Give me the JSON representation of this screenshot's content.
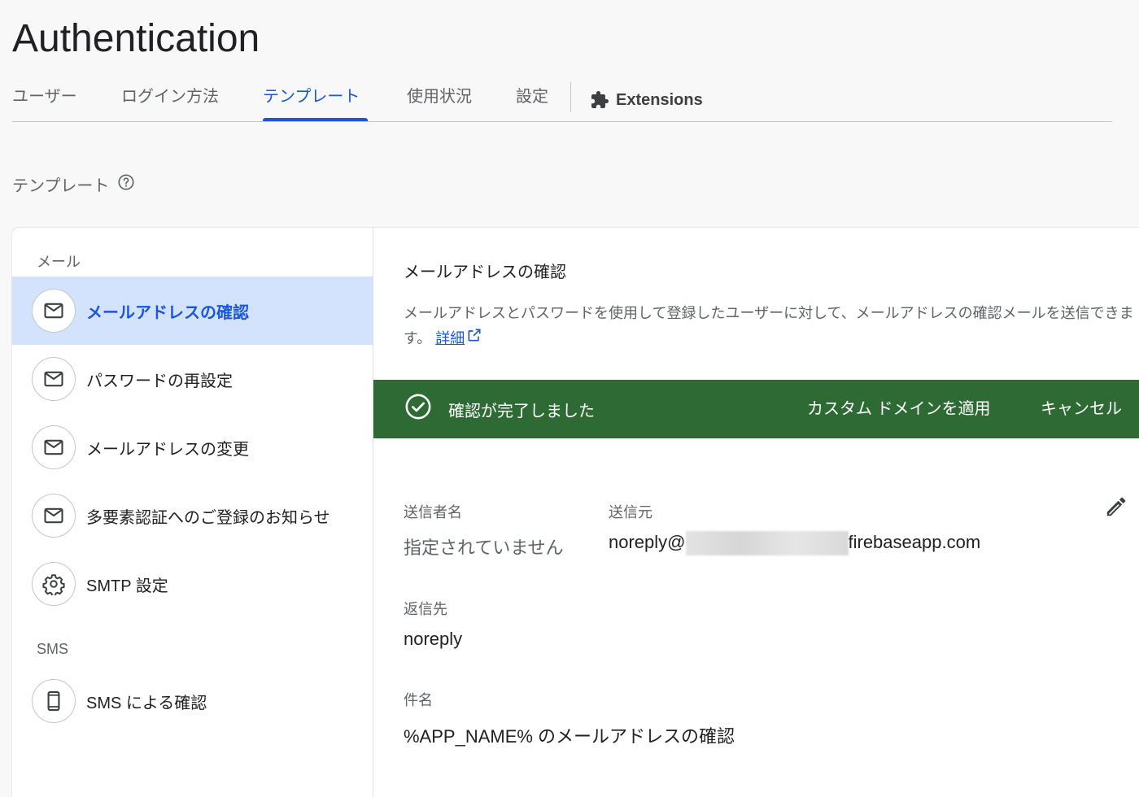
{
  "page": {
    "title": "Authentication"
  },
  "tabs": [
    {
      "label": "ユーザー",
      "active": false
    },
    {
      "label": "ログイン方法",
      "active": false
    },
    {
      "label": "テンプレート",
      "active": true
    },
    {
      "label": "使用状況",
      "active": false
    },
    {
      "label": "設定",
      "active": false
    },
    {
      "label": "Extensions",
      "icon": "extension-icon",
      "active": false
    }
  ],
  "section": {
    "label": "テンプレート",
    "help_icon": "help-icon"
  },
  "sidebar": {
    "groups": [
      {
        "label": "メール",
        "items": [
          {
            "label": "メールアドレスの確認",
            "icon": "mail-icon",
            "active": true
          },
          {
            "label": "パスワードの再設定",
            "icon": "mail-icon",
            "active": false
          },
          {
            "label": "メールアドレスの変更",
            "icon": "mail-icon",
            "active": false
          },
          {
            "label": "多要素認証へのご登録のお知らせ",
            "icon": "mail-icon",
            "active": false
          },
          {
            "label": "SMTP 設定",
            "icon": "gear-icon",
            "active": false
          }
        ]
      },
      {
        "label": "SMS",
        "items": [
          {
            "label": "SMS による確認",
            "icon": "phone-icon",
            "active": false
          }
        ]
      }
    ]
  },
  "content": {
    "title": "メールアドレスの確認",
    "description": "メールアドレスとパスワードを使用して登録したユーザーに対して、メールアドレスの確認メールを送信できます。",
    "details_link": "詳細",
    "banner": {
      "message": "確認が完了しました",
      "apply_domain": "カスタム ドメインを適用",
      "cancel": "キャンセル",
      "color": "#2e6b34"
    },
    "fields": {
      "sender_name_label": "送信者名",
      "sender_name_value": "指定されていません",
      "from_label": "送信元",
      "from_prefix": "noreply@",
      "from_suffix": "firebaseapp.com",
      "reply_to_label": "返信先",
      "reply_to_value": "noreply",
      "subject_label": "件名",
      "subject_value": "%APP_NAME% のメールアドレスの確認"
    }
  },
  "colors": {
    "accent": "#1a56db",
    "active_bg": "#d3e3fd",
    "success": "#2e6b34"
  }
}
